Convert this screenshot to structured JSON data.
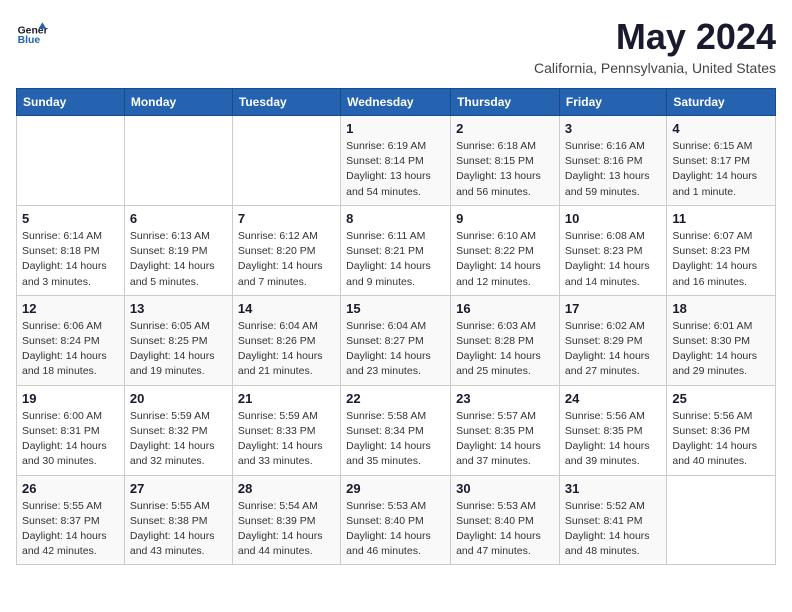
{
  "header": {
    "logo_line1": "General",
    "logo_line2": "Blue",
    "month_title": "May 2024",
    "location": "California, Pennsylvania, United States"
  },
  "weekdays": [
    "Sunday",
    "Monday",
    "Tuesday",
    "Wednesday",
    "Thursday",
    "Friday",
    "Saturday"
  ],
  "weeks": [
    [
      {
        "day": "",
        "info": ""
      },
      {
        "day": "",
        "info": ""
      },
      {
        "day": "",
        "info": ""
      },
      {
        "day": "1",
        "info": "Sunrise: 6:19 AM\nSunset: 8:14 PM\nDaylight: 13 hours\nand 54 minutes."
      },
      {
        "day": "2",
        "info": "Sunrise: 6:18 AM\nSunset: 8:15 PM\nDaylight: 13 hours\nand 56 minutes."
      },
      {
        "day": "3",
        "info": "Sunrise: 6:16 AM\nSunset: 8:16 PM\nDaylight: 13 hours\nand 59 minutes."
      },
      {
        "day": "4",
        "info": "Sunrise: 6:15 AM\nSunset: 8:17 PM\nDaylight: 14 hours\nand 1 minute."
      }
    ],
    [
      {
        "day": "5",
        "info": "Sunrise: 6:14 AM\nSunset: 8:18 PM\nDaylight: 14 hours\nand 3 minutes."
      },
      {
        "day": "6",
        "info": "Sunrise: 6:13 AM\nSunset: 8:19 PM\nDaylight: 14 hours\nand 5 minutes."
      },
      {
        "day": "7",
        "info": "Sunrise: 6:12 AM\nSunset: 8:20 PM\nDaylight: 14 hours\nand 7 minutes."
      },
      {
        "day": "8",
        "info": "Sunrise: 6:11 AM\nSunset: 8:21 PM\nDaylight: 14 hours\nand 9 minutes."
      },
      {
        "day": "9",
        "info": "Sunrise: 6:10 AM\nSunset: 8:22 PM\nDaylight: 14 hours\nand 12 minutes."
      },
      {
        "day": "10",
        "info": "Sunrise: 6:08 AM\nSunset: 8:23 PM\nDaylight: 14 hours\nand 14 minutes."
      },
      {
        "day": "11",
        "info": "Sunrise: 6:07 AM\nSunset: 8:23 PM\nDaylight: 14 hours\nand 16 minutes."
      }
    ],
    [
      {
        "day": "12",
        "info": "Sunrise: 6:06 AM\nSunset: 8:24 PM\nDaylight: 14 hours\nand 18 minutes."
      },
      {
        "day": "13",
        "info": "Sunrise: 6:05 AM\nSunset: 8:25 PM\nDaylight: 14 hours\nand 19 minutes."
      },
      {
        "day": "14",
        "info": "Sunrise: 6:04 AM\nSunset: 8:26 PM\nDaylight: 14 hours\nand 21 minutes."
      },
      {
        "day": "15",
        "info": "Sunrise: 6:04 AM\nSunset: 8:27 PM\nDaylight: 14 hours\nand 23 minutes."
      },
      {
        "day": "16",
        "info": "Sunrise: 6:03 AM\nSunset: 8:28 PM\nDaylight: 14 hours\nand 25 minutes."
      },
      {
        "day": "17",
        "info": "Sunrise: 6:02 AM\nSunset: 8:29 PM\nDaylight: 14 hours\nand 27 minutes."
      },
      {
        "day": "18",
        "info": "Sunrise: 6:01 AM\nSunset: 8:30 PM\nDaylight: 14 hours\nand 29 minutes."
      }
    ],
    [
      {
        "day": "19",
        "info": "Sunrise: 6:00 AM\nSunset: 8:31 PM\nDaylight: 14 hours\nand 30 minutes."
      },
      {
        "day": "20",
        "info": "Sunrise: 5:59 AM\nSunset: 8:32 PM\nDaylight: 14 hours\nand 32 minutes."
      },
      {
        "day": "21",
        "info": "Sunrise: 5:59 AM\nSunset: 8:33 PM\nDaylight: 14 hours\nand 33 minutes."
      },
      {
        "day": "22",
        "info": "Sunrise: 5:58 AM\nSunset: 8:34 PM\nDaylight: 14 hours\nand 35 minutes."
      },
      {
        "day": "23",
        "info": "Sunrise: 5:57 AM\nSunset: 8:35 PM\nDaylight: 14 hours\nand 37 minutes."
      },
      {
        "day": "24",
        "info": "Sunrise: 5:56 AM\nSunset: 8:35 PM\nDaylight: 14 hours\nand 39 minutes."
      },
      {
        "day": "25",
        "info": "Sunrise: 5:56 AM\nSunset: 8:36 PM\nDaylight: 14 hours\nand 40 minutes."
      }
    ],
    [
      {
        "day": "26",
        "info": "Sunrise: 5:55 AM\nSunset: 8:37 PM\nDaylight: 14 hours\nand 42 minutes."
      },
      {
        "day": "27",
        "info": "Sunrise: 5:55 AM\nSunset: 8:38 PM\nDaylight: 14 hours\nand 43 minutes."
      },
      {
        "day": "28",
        "info": "Sunrise: 5:54 AM\nSunset: 8:39 PM\nDaylight: 14 hours\nand 44 minutes."
      },
      {
        "day": "29",
        "info": "Sunrise: 5:53 AM\nSunset: 8:40 PM\nDaylight: 14 hours\nand 46 minutes."
      },
      {
        "day": "30",
        "info": "Sunrise: 5:53 AM\nSunset: 8:40 PM\nDaylight: 14 hours\nand 47 minutes."
      },
      {
        "day": "31",
        "info": "Sunrise: 5:52 AM\nSunset: 8:41 PM\nDaylight: 14 hours\nand 48 minutes."
      },
      {
        "day": "",
        "info": ""
      }
    ]
  ]
}
